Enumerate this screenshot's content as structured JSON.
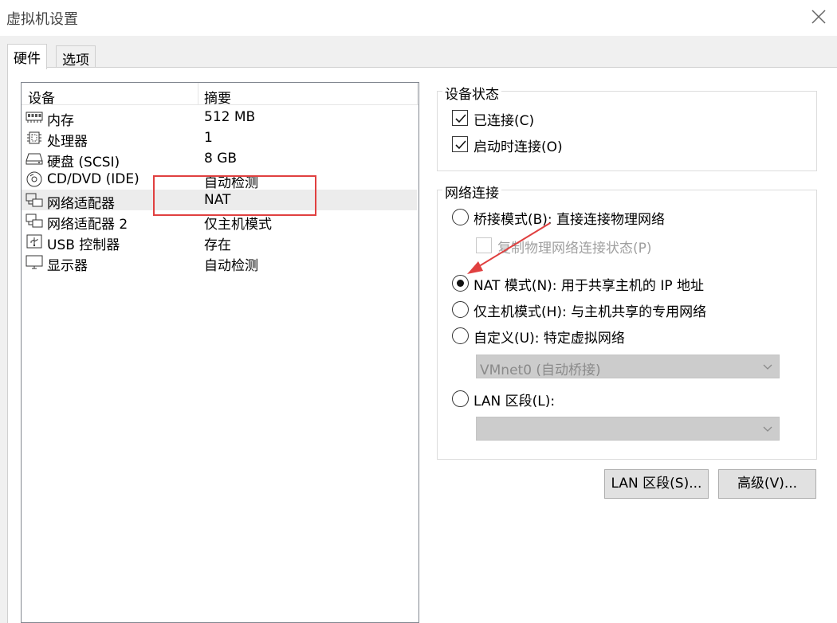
{
  "window": {
    "title": "虚拟机设置",
    "close_icon": "close-icon"
  },
  "tabs": [
    {
      "label": "硬件",
      "active": true
    },
    {
      "label": "选项",
      "active": false
    }
  ],
  "device_list": {
    "headers": {
      "device": "设备",
      "summary": "摘要"
    },
    "rows": [
      {
        "icon": "memory-icon",
        "name": "内存",
        "summary": "512 MB",
        "selected": false
      },
      {
        "icon": "processor-icon",
        "name": "处理器",
        "summary": "1",
        "selected": false
      },
      {
        "icon": "hard-disk-icon",
        "name": "硬盘 (SCSI)",
        "summary": "8 GB",
        "selected": false
      },
      {
        "icon": "cd-dvd-icon",
        "name": "CD/DVD (IDE)",
        "summary": "自动检测",
        "selected": false
      },
      {
        "icon": "network-adapter-icon",
        "name": "网络适配器",
        "summary": "NAT",
        "selected": true
      },
      {
        "icon": "network-adapter-icon",
        "name": "网络适配器 2",
        "summary": "仅主机模式",
        "selected": false
      },
      {
        "icon": "usb-icon",
        "name": "USB 控制器",
        "summary": "存在",
        "selected": false
      },
      {
        "icon": "display-icon",
        "name": "显示器",
        "summary": "自动检测",
        "selected": false
      }
    ]
  },
  "device_status": {
    "title": "设备状态",
    "connected": {
      "label": "已连接(C)",
      "checked": true
    },
    "connect_at_power_on": {
      "label": "启动时连接(O)",
      "checked": true
    }
  },
  "network_connection": {
    "title": "网络连接",
    "bridged": {
      "label": "桥接模式(B): 直接连接物理网络",
      "selected": false
    },
    "replicate": {
      "label": "复制物理网络连接状态(P)",
      "checked": false,
      "enabled": false
    },
    "nat": {
      "label": "NAT 模式(N): 用于共享主机的 IP 地址",
      "selected": true
    },
    "host_only": {
      "label": "仅主机模式(H): 与主机共享的专用网络",
      "selected": false
    },
    "custom": {
      "label": "自定义(U): 特定虚拟网络",
      "selected": false
    },
    "custom_combo": {
      "value": "VMnet0 (自动桥接)",
      "enabled": false
    },
    "lan_segment": {
      "label": "LAN 区段(L):",
      "selected": false
    },
    "lan_combo": {
      "value": "",
      "enabled": false
    }
  },
  "buttons": {
    "lan_segments": "LAN 区段(S)...",
    "advanced": "高级(V)..."
  },
  "colors": {
    "annotation_red": "#e04040",
    "selection_bg": "#ececec",
    "disabled_text": "#a0a0a0"
  }
}
